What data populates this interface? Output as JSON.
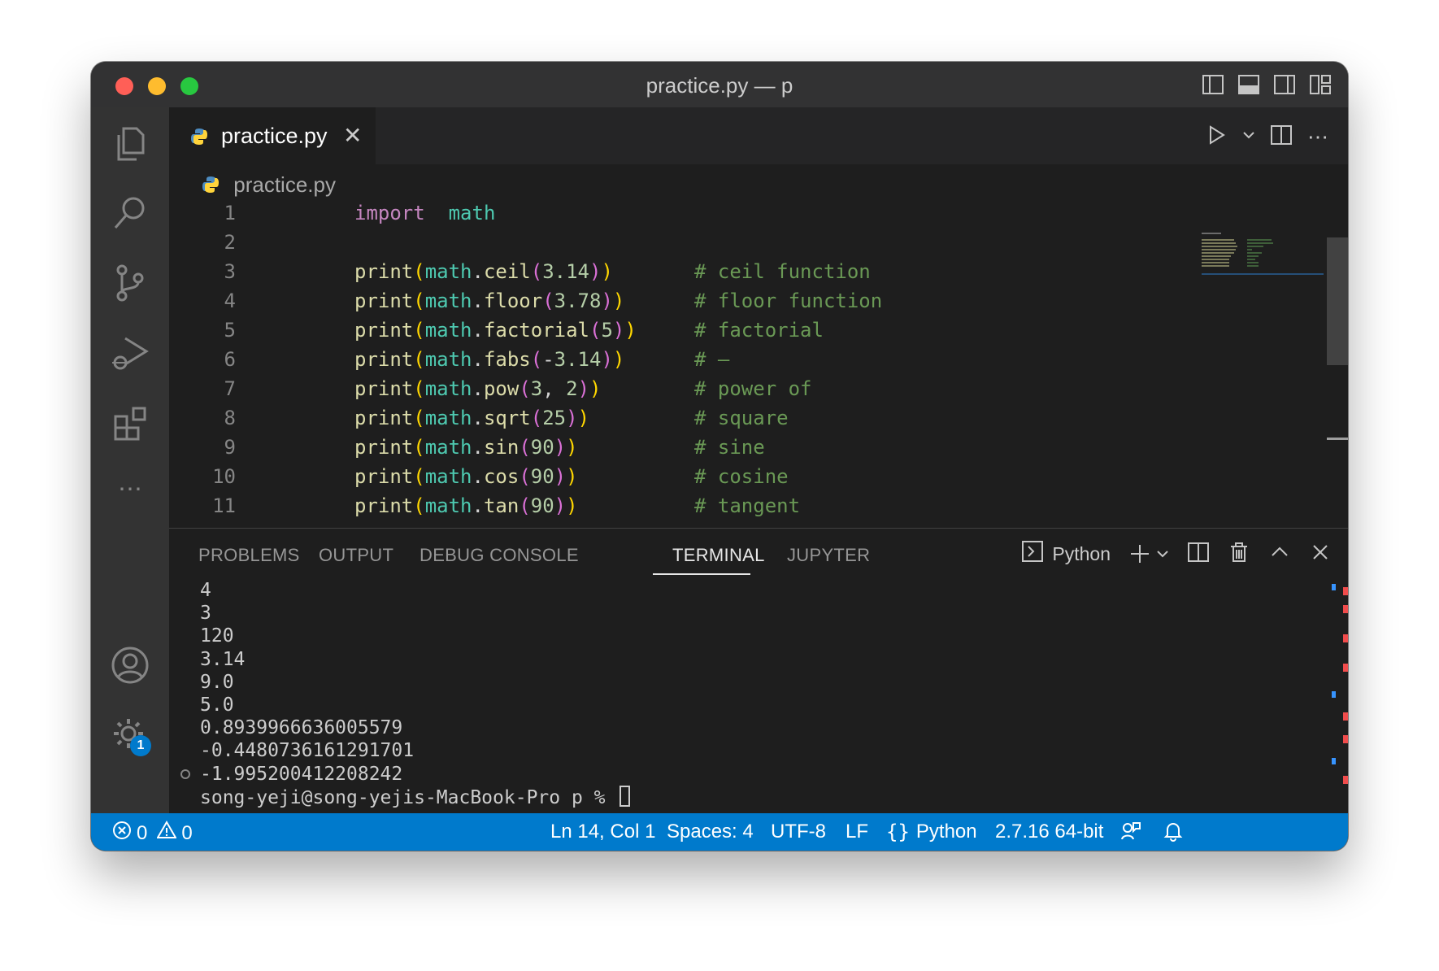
{
  "window": {
    "title": "practice.py — p"
  },
  "tab": {
    "label": "practice.py",
    "close_icon": "close-icon",
    "file_icon": "python-icon"
  },
  "breadcrumb": {
    "label": "practice.py"
  },
  "code": [
    {
      "n": "1",
      "tokens": [
        [
          "kw",
          "import"
        ],
        [
          "",
          "  "
        ],
        [
          "mod",
          "math"
        ]
      ],
      "comment": ""
    },
    {
      "n": "2",
      "tokens": [],
      "comment": ""
    },
    {
      "n": "3",
      "tokens": [
        [
          "fn",
          "print"
        ],
        [
          "p1",
          "("
        ],
        [
          "mod",
          "math"
        ],
        [
          "",
          "."
        ],
        [
          "fn",
          "ceil"
        ],
        [
          "p2",
          "("
        ],
        [
          "num",
          "3.14"
        ],
        [
          "p2",
          ")"
        ],
        [
          "p1",
          ")"
        ]
      ],
      "comment": "# ceil function"
    },
    {
      "n": "4",
      "tokens": [
        [
          "fn",
          "print"
        ],
        [
          "p1",
          "("
        ],
        [
          "mod",
          "math"
        ],
        [
          "",
          "."
        ],
        [
          "fn",
          "floor"
        ],
        [
          "p2",
          "("
        ],
        [
          "num",
          "3.78"
        ],
        [
          "p2",
          ")"
        ],
        [
          "p1",
          ")"
        ]
      ],
      "comment": "# floor function"
    },
    {
      "n": "5",
      "tokens": [
        [
          "fn",
          "print"
        ],
        [
          "p1",
          "("
        ],
        [
          "mod",
          "math"
        ],
        [
          "",
          "."
        ],
        [
          "fn",
          "factorial"
        ],
        [
          "p2",
          "("
        ],
        [
          "num",
          "5"
        ],
        [
          "p2",
          ")"
        ],
        [
          "p1",
          ")"
        ]
      ],
      "comment": "# factorial"
    },
    {
      "n": "6",
      "tokens": [
        [
          "fn",
          "print"
        ],
        [
          "p1",
          "("
        ],
        [
          "mod",
          "math"
        ],
        [
          "",
          "."
        ],
        [
          "fn",
          "fabs"
        ],
        [
          "p2",
          "("
        ],
        [
          "",
          "-"
        ],
        [
          "num",
          "3.14"
        ],
        [
          "p2",
          ")"
        ],
        [
          "p1",
          ")"
        ]
      ],
      "comment": "# –"
    },
    {
      "n": "7",
      "tokens": [
        [
          "fn",
          "print"
        ],
        [
          "p1",
          "("
        ],
        [
          "mod",
          "math"
        ],
        [
          "",
          "."
        ],
        [
          "fn",
          "pow"
        ],
        [
          "p2",
          "("
        ],
        [
          "num",
          "3"
        ],
        [
          "",
          ", "
        ],
        [
          "num",
          "2"
        ],
        [
          "p2",
          ")"
        ],
        [
          "p1",
          ")"
        ]
      ],
      "comment": "# power of"
    },
    {
      "n": "8",
      "tokens": [
        [
          "fn",
          "print"
        ],
        [
          "p1",
          "("
        ],
        [
          "mod",
          "math"
        ],
        [
          "",
          "."
        ],
        [
          "fn",
          "sqrt"
        ],
        [
          "p2",
          "("
        ],
        [
          "num",
          "25"
        ],
        [
          "p2",
          ")"
        ],
        [
          "p1",
          ")"
        ]
      ],
      "comment": "# square"
    },
    {
      "n": "9",
      "tokens": [
        [
          "fn",
          "print"
        ],
        [
          "p1",
          "("
        ],
        [
          "mod",
          "math"
        ],
        [
          "",
          "."
        ],
        [
          "fn",
          "sin"
        ],
        [
          "p2",
          "("
        ],
        [
          "num",
          "90"
        ],
        [
          "p2",
          ")"
        ],
        [
          "p1",
          ")"
        ]
      ],
      "comment": "# sine"
    },
    {
      "n": "10",
      "tokens": [
        [
          "fn",
          "print"
        ],
        [
          "p1",
          "("
        ],
        [
          "mod",
          "math"
        ],
        [
          "",
          "."
        ],
        [
          "fn",
          "cos"
        ],
        [
          "p2",
          "("
        ],
        [
          "num",
          "90"
        ],
        [
          "p2",
          ")"
        ],
        [
          "p1",
          ")"
        ]
      ],
      "comment": "# cosine"
    },
    {
      "n": "11",
      "tokens": [
        [
          "fn",
          "print"
        ],
        [
          "p1",
          "("
        ],
        [
          "mod",
          "math"
        ],
        [
          "",
          "."
        ],
        [
          "fn",
          "tan"
        ],
        [
          "p2",
          "("
        ],
        [
          "num",
          "90"
        ],
        [
          "p2",
          ")"
        ],
        [
          "p1",
          ")"
        ]
      ],
      "comment": "# tangent"
    }
  ],
  "panel": {
    "tabs": [
      "PROBLEMS",
      "OUTPUT",
      "DEBUG CONSOLE",
      "TERMINAL",
      "JUPYTER"
    ],
    "active_tab": "TERMINAL",
    "terminal_profile": "Python"
  },
  "terminal": {
    "lines": [
      "4",
      "3",
      "120",
      "3.14",
      "9.0",
      "5.0",
      "0.8939966636005579",
      "-0.4480736161291701",
      "-1.995200412208242"
    ],
    "prompt": "song-yeji@song-yejis-MacBook-Pro p % "
  },
  "status": {
    "errors": "0",
    "warnings": "0",
    "position": "Ln 14, Col 1",
    "spaces": "Spaces: 4",
    "encoding": "UTF-8",
    "eol": "LF",
    "language": "Python",
    "interpreter": "2.7.16 64-bit"
  },
  "activity": {
    "accounts_badge": "1"
  },
  "colors": {
    "accent": "#007acc",
    "background": "#1e1e1e",
    "comment": "#6a9955"
  }
}
